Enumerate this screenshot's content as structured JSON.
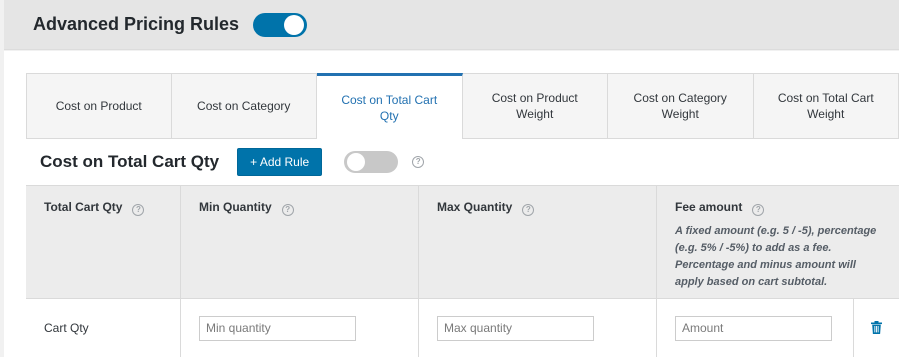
{
  "header": {
    "title": "Advanced Pricing Rules",
    "toggle_state": "on"
  },
  "tabs": [
    {
      "label": "Cost on Product",
      "active": false
    },
    {
      "label": "Cost on Category",
      "active": false
    },
    {
      "label": "Cost on Total Cart Qty",
      "active": true
    },
    {
      "label": "Cost on Product Weight",
      "active": false
    },
    {
      "label": "Cost on Category Weight",
      "active": false
    },
    {
      "label": "Cost on Total Cart Weight",
      "active": false
    }
  ],
  "section": {
    "title": "Cost on Total Cart Qty",
    "add_rule_label": "+ Add Rule",
    "toggle_state": "off",
    "help_icon": "question-circle-icon"
  },
  "table": {
    "columns": [
      {
        "label": "Total Cart Qty"
      },
      {
        "label": "Min Quantity"
      },
      {
        "label": "Max Quantity"
      },
      {
        "label": "Fee amount",
        "description": "A fixed amount (e.g. 5 / -5), percentage (e.g. 5% / -5%) to add as a fee. Percentage and minus amount will apply based on cart subtotal."
      }
    ],
    "rows": [
      {
        "label": "Cart Qty",
        "min_placeholder": "Min quantity",
        "max_placeholder": "Max quantity",
        "fee_placeholder": "Amount",
        "delete_icon": "trash-icon"
      }
    ]
  },
  "colors": {
    "accent": "#0073aa",
    "active_tab_text": "#2271b1",
    "header_bg": "#e5e5e5",
    "table_header_bg": "#ececec"
  }
}
